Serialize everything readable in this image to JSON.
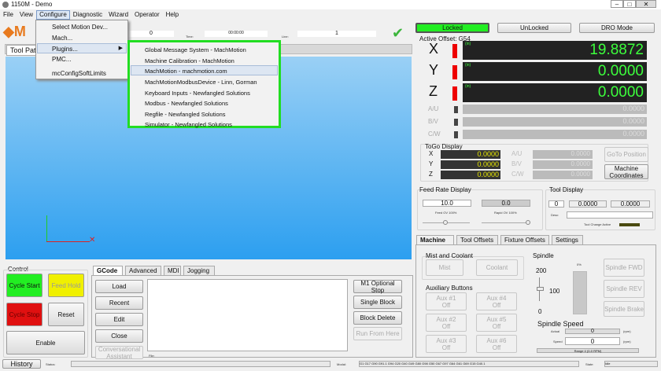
{
  "window": {
    "title": "1150M - Demo"
  },
  "menubar": [
    "File",
    "View",
    "Configure",
    "Diagnostic",
    "Wizard",
    "Operator",
    "Help"
  ],
  "configure_menu": [
    "Select Motion Dev...",
    "Mach...",
    "Plugins...",
    "PMC...",
    "mcConfigSoftLimits"
  ],
  "plugins_menu": [
    "Global Message System - MachMotion",
    "Machine Calibration - MachMotion",
    "MachMotion - machmotion.com",
    "MachMotionModbusDevice - Linn, Gorman",
    "Keyboard Inputs - Newfangled Solutions",
    "Modbus - Newfangled Solutions",
    "Regfile - Newfangled Solutions",
    "Simulator - Newfangled Solutions"
  ],
  "plugins_highlight_color": "#22dd22",
  "toolbar": {
    "field1": "0",
    "time_label": "Time:",
    "time_value": "00:00:00",
    "line_label": "Line:",
    "line_value": "1"
  },
  "toolpath_tab": "Tool Path",
  "status_buttons": {
    "locked": "Locked",
    "unlocked": "UnLocked",
    "dro_mode": "DRO Mode"
  },
  "dro": {
    "active_offset": "Active Offset: G54",
    "unit": "(in)",
    "axes": [
      {
        "name": "X",
        "value": "19.8872"
      },
      {
        "name": "Y",
        "value": "0.0000"
      },
      {
        "name": "Z",
        "value": "0.0000"
      }
    ],
    "aux_axes": [
      {
        "name": "A/U",
        "value": "0.0000"
      },
      {
        "name": "B/V",
        "value": "0.0000"
      },
      {
        "name": "C/W",
        "value": "0.0000"
      }
    ]
  },
  "togo": {
    "title": "ToGo Display",
    "rows": [
      {
        "a": "X",
        "v": "0.0000",
        "b": "A/U",
        "w": "0.0000"
      },
      {
        "a": "Y",
        "v": "0.0000",
        "b": "B/V",
        "w": "0.0000"
      },
      {
        "a": "Z",
        "v": "0.0000",
        "b": "C/W",
        "w": "0.0000"
      }
    ],
    "goto": "GoTo Position",
    "machine_coords": "Machine Coordinates"
  },
  "feed": {
    "title": "Feed Rate Display",
    "feed": "10.0",
    "rapid": "0.0",
    "feed_ov": "Feed OV 100%",
    "rapid_ov": "Rapid OV 100%",
    "feed_ov_percent": 100,
    "rapid_ov_percent": 100
  },
  "tool": {
    "title": "Tool Display",
    "number": "0",
    "v1": "0.0000",
    "v2": "0.0000",
    "desc_label": "Desc:",
    "change_active": "Tool Change Active"
  },
  "tabs_right": [
    "Machine",
    "Tool Offsets",
    "Fixture Offsets",
    "Settings"
  ],
  "mist": {
    "title": "Mist and Coolant",
    "mist": "Mist",
    "coolant": "Coolant"
  },
  "aux": {
    "title": "Auxiliary Buttons",
    "buttons": [
      "Aux #1 Off",
      "Aux #4 Off",
      "Aux #2 Off",
      "Aux #5 Off",
      "Aux #3 Off",
      "Aux #6 Off"
    ]
  },
  "spindle": {
    "title": "Spindle",
    "max": "200",
    "mid": "100",
    "min": "0",
    "percent": "0%",
    "override": 100,
    "fwd": "Spindle FWD",
    "rev": "Spindle REV",
    "brake": "Spindle Brake",
    "speed_title": "Spindle Speed",
    "actual_label": "Actual",
    "actual": "0",
    "rpm": "(rpm)",
    "speed_label": "Speed",
    "speed": "0",
    "range": "Range 4 (0-0 RPM)"
  },
  "control": {
    "title": "Control",
    "cycle_start": "Cycle Start",
    "feed_hold": "Feed Hold",
    "cycle_stop": "Cycle Stop",
    "reset": "Reset",
    "enable": "Enable"
  },
  "gcode_tabs": [
    "GCode",
    "Advanced",
    "MDI",
    "Jogging"
  ],
  "gcode_buttons": [
    "Load",
    "Recent",
    "Edit",
    "Close",
    "Conversational Assistant"
  ],
  "gcode_right": [
    "M1 Optional Stop",
    "Single Block",
    "Block Delete",
    "Run From Here"
  ],
  "file_label": "File:",
  "statusbar": {
    "history": "History",
    "status_label": "Status:",
    "modal_label": "Modal:",
    "modal": "G1 G17 G90 G91.1 G94 G20 G40 G49 G80 G98 G50 G67 G97 G64 G61 G69 G15 G40.1",
    "state_label": "State:",
    "state": "Idle"
  }
}
